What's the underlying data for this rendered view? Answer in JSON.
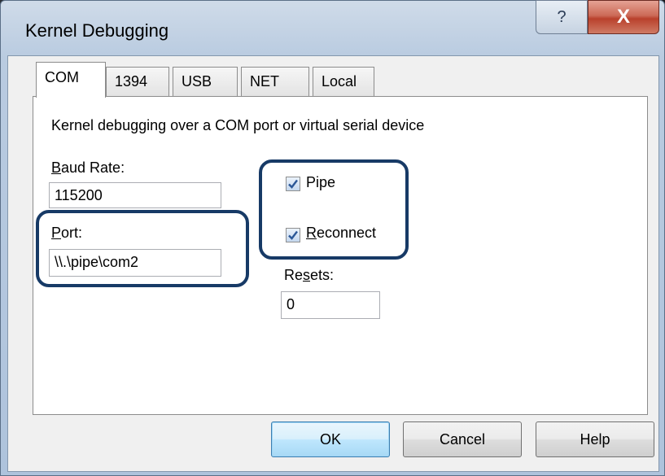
{
  "window": {
    "title": "Kernel Debugging",
    "help_glyph": "?",
    "close_glyph": "X"
  },
  "tabs": [
    {
      "label": "COM",
      "active": true
    },
    {
      "label": "1394",
      "active": false
    },
    {
      "label": "USB",
      "active": false
    },
    {
      "label": "NET",
      "active": false
    },
    {
      "label": "Local",
      "active": false
    }
  ],
  "panel": {
    "description": "Kernel debugging over a COM port or virtual serial device",
    "baud_rate": {
      "label_accel": "B",
      "label_rest": "aud Rate:",
      "value": "115200"
    },
    "port": {
      "label_accel": "P",
      "label_rest": "ort:",
      "value": "\\\\.\\pipe\\com2"
    },
    "pipe": {
      "label": "Pipe",
      "checked": true
    },
    "reconnect": {
      "label_accel": "R",
      "label_rest": "econnect",
      "checked": true
    },
    "resets": {
      "label_pre": "Re",
      "label_accel": "s",
      "label_post": "ets:",
      "value": "0"
    }
  },
  "buttons": {
    "ok": "OK",
    "cancel": "Cancel",
    "help": "Help"
  },
  "colors": {
    "highlight": "#173a66",
    "check": "#2b5797"
  }
}
